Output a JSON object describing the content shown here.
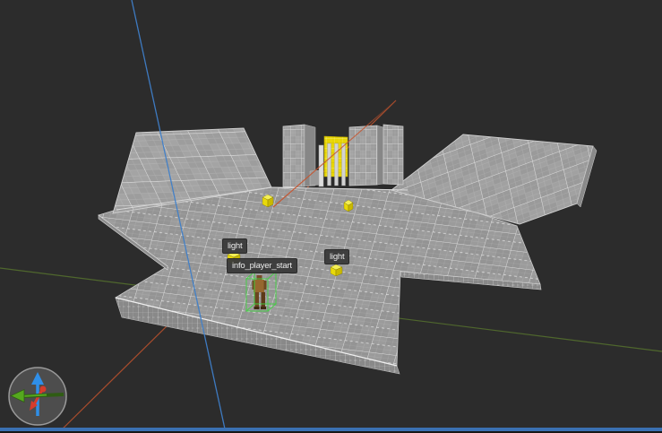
{
  "viewport": {
    "type_note": "3D map editor perspective viewport",
    "background_color": "#2c2c2c",
    "focus_border_color": "#3a70b2"
  },
  "labels": {
    "light_a": "light",
    "player_start": "info_player_start",
    "light_b": "light"
  },
  "axes": {
    "x_color": "#b5502c",
    "y_color": "#56722e",
    "z_color": "#3f7fc9"
  },
  "selection": {
    "wireframe_color": "#3fd43f"
  },
  "entities": {
    "light_cube_color": "#e8d90a",
    "light_count": 4,
    "player_start_count": 1
  },
  "compass": {
    "up_arrow_color": "#2f8fe8",
    "left_arrow_color": "#55a81e",
    "toward_viewer_arrow_color": "#d63c2c",
    "ring_color": "#9a9a9a"
  }
}
